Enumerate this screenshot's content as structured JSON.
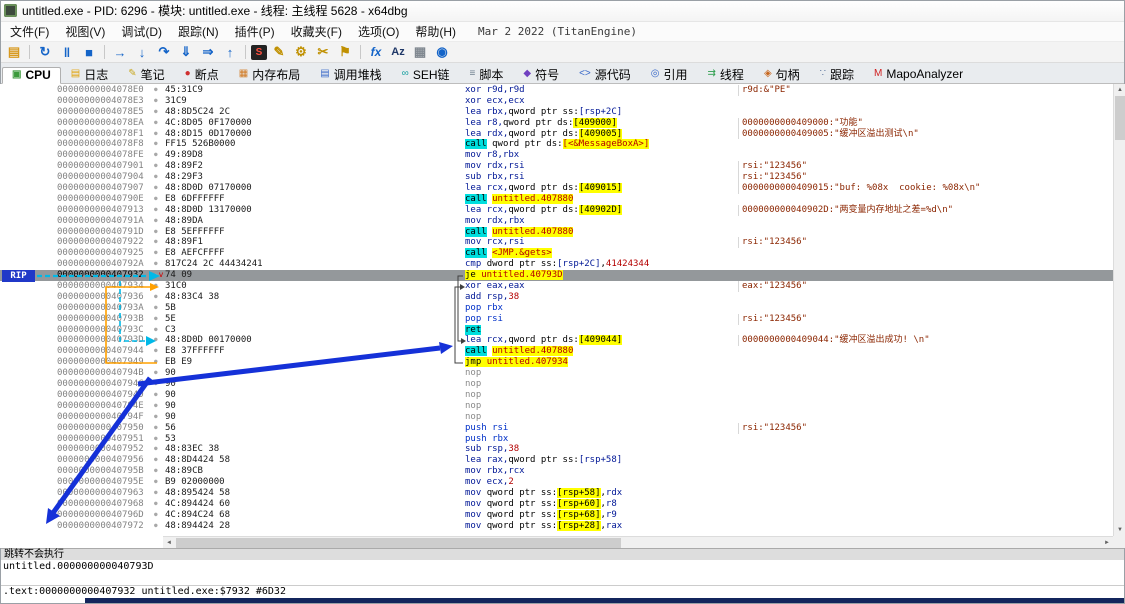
{
  "window": {
    "title": "untitled.exe - PID: 6296 - 模块: untitled.exe - 线程: 主线程 5628 - x64dbg"
  },
  "menu": {
    "items": [
      {
        "name": "menu-file",
        "label": "文件(F)"
      },
      {
        "name": "menu-view",
        "label": "视图(V)"
      },
      {
        "name": "menu-debug",
        "label": "调试(D)"
      },
      {
        "name": "menu-trace",
        "label": "跟踪(N)"
      },
      {
        "name": "menu-plugins",
        "label": "插件(P)"
      },
      {
        "name": "menu-favourites",
        "label": "收藏夹(F)"
      },
      {
        "name": "menu-options",
        "label": "选项(O)"
      },
      {
        "name": "menu-help",
        "label": "帮助(H)"
      }
    ],
    "right_text": "Mar 2 2022 (TitanEngine)"
  },
  "toolbar": {
    "buttons": [
      {
        "name": "open-file-button",
        "glyph": "▤",
        "color": "#d89a20"
      },
      {
        "sep": true
      },
      {
        "name": "restart-button",
        "glyph": "↻",
        "color": "#1464c8"
      },
      {
        "name": "pause-button",
        "glyph": "‖",
        "color": "#1464c8"
      },
      {
        "name": "stop-button",
        "glyph": "■",
        "color": "#1464c8"
      },
      {
        "sep": true
      },
      {
        "name": "run-button",
        "glyph": "→",
        "color": "#1464c8"
      },
      {
        "name": "step-into-button",
        "glyph": "↓",
        "color": "#1464c8"
      },
      {
        "name": "step-over-button",
        "glyph": "↷",
        "color": "#1464c8"
      },
      {
        "name": "trace-into-button",
        "glyph": "⇓",
        "color": "#1464c8"
      },
      {
        "name": "trace-over-button",
        "glyph": "⇒",
        "color": "#1464c8"
      },
      {
        "name": "execute-till-return-button",
        "glyph": "↑",
        "color": "#1464c8"
      },
      {
        "sep": true
      },
      {
        "name": "script-button",
        "glyph": "S",
        "kind": "sbox"
      },
      {
        "name": "notes-button",
        "glyph": "✎",
        "color": "#c09000"
      },
      {
        "name": "settings-button",
        "glyph": "⚙",
        "color": "#c09000"
      },
      {
        "name": "patches-button",
        "glyph": "✂",
        "color": "#c09000"
      },
      {
        "name": "favourites-button",
        "glyph": "⚑",
        "color": "#c09000"
      },
      {
        "sep": true
      },
      {
        "name": "expression-button",
        "glyph": "fx",
        "kind": "fx",
        "color": "#1464c8"
      },
      {
        "name": "strings-button",
        "glyph": "Az",
        "kind": "text",
        "color": "#203868"
      },
      {
        "name": "memory-map-button",
        "glyph": "▦",
        "color": "#808890"
      },
      {
        "name": "about-button",
        "glyph": "◉",
        "color": "#1464c8"
      }
    ]
  },
  "tabs": {
    "items": [
      {
        "name": "tab-cpu",
        "label": "CPU",
        "glyph": "▣",
        "color": "#3c9a3c",
        "selected": true
      },
      {
        "name": "tab-log",
        "label": "日志",
        "glyph": "▤",
        "color": "#e0a000"
      },
      {
        "name": "tab-notes",
        "label": "笔记",
        "glyph": "✎",
        "color": "#c8a820"
      },
      {
        "name": "tab-breakpoints",
        "label": "断点",
        "glyph": "●",
        "color": "#d03030"
      },
      {
        "name": "tab-memory-map",
        "label": "内存布局",
        "glyph": "▦",
        "color": "#d07820"
      },
      {
        "name": "tab-call-stack",
        "label": "调用堆栈",
        "glyph": "▤",
        "color": "#3868c8"
      },
      {
        "name": "tab-seh",
        "label": "SEH链",
        "glyph": "∞",
        "color": "#18a0a0"
      },
      {
        "name": "tab-script",
        "label": "脚本",
        "glyph": "≡",
        "color": "#708090"
      },
      {
        "name": "tab-symbols",
        "label": "符号",
        "glyph": "◆",
        "color": "#7040c0"
      },
      {
        "name": "tab-source",
        "label": "源代码",
        "glyph": "<>",
        "color": "#3868c8"
      },
      {
        "name": "tab-references",
        "label": "引用",
        "glyph": "◎",
        "color": "#3868c8"
      },
      {
        "name": "tab-threads",
        "label": "线程",
        "glyph": "⇉",
        "color": "#30a050"
      },
      {
        "name": "tab-handles",
        "label": "句柄",
        "glyph": "◈",
        "color": "#c86820"
      },
      {
        "name": "tab-trace",
        "label": "跟踪",
        "glyph": "∵",
        "color": "#6078a0"
      },
      {
        "name": "tab-mapo",
        "label": "MapoAnalyzer",
        "glyph": "M",
        "color": "#d02020"
      }
    ]
  },
  "disasm": {
    "rip_label": "RIP",
    "rows": [
      {
        "addr": "00000000004078E0",
        "bytes": "45:31C9",
        "instr": [
          [
            "xor r9d,r9d",
            "mn"
          ]
        ],
        "comment": "r9d:&\"PE\""
      },
      {
        "addr": "00000000004078E3",
        "bytes": "31C9",
        "instr": [
          [
            "xor ecx,ecx",
            "mn"
          ]
        ],
        "comment": ""
      },
      {
        "addr": "00000000004078E5",
        "bytes": "48:8D5C24 2C",
        "instr": [
          [
            "lea rbx,",
            "mn"
          ],
          [
            "qword ptr ss:",
            "pl"
          ],
          [
            "[rsp+2C]",
            "mn"
          ]
        ],
        "comment": ""
      },
      {
        "addr": "00000000004078EA",
        "bytes": "4C:8D05 0F170000",
        "instr": [
          [
            "lea r8,",
            "mn"
          ],
          [
            "qword ptr ds:",
            "pl"
          ],
          [
            "[409000]",
            "tgtk"
          ]
        ],
        "comment": "0000000000409000:\"功能\""
      },
      {
        "addr": "00000000004078F1",
        "bytes": "48:8D15 0D170000",
        "instr": [
          [
            "lea rdx,",
            "mn"
          ],
          [
            "qword ptr ds:",
            "pl"
          ],
          [
            "[409005]",
            "tgtk"
          ]
        ],
        "comment": "0000000000409005:\"缓冲区溢出测试\\n\""
      },
      {
        "addr": "00000000004078F8",
        "bytes": "FF15 526B0000",
        "instr": [
          [
            "call",
            "call"
          ],
          [
            " qword ptr ds:",
            "pl"
          ],
          [
            "[<&MessageBoxA>]",
            "tgt"
          ]
        ],
        "comment": ""
      },
      {
        "addr": "00000000004078FE",
        "bytes": "49:89D8",
        "instr": [
          [
            "mov r8,rbx",
            "mn"
          ]
        ],
        "comment": ""
      },
      {
        "addr": "0000000000407901",
        "bytes": "48:89F2",
        "instr": [
          [
            "mov rdx,rsi",
            "mn"
          ]
        ],
        "comment": "rsi:\"123456\""
      },
      {
        "addr": "0000000000407904",
        "bytes": "48:29F3",
        "instr": [
          [
            "sub rbx,rsi",
            "mn"
          ]
        ],
        "comment": "rsi:\"123456\""
      },
      {
        "addr": "0000000000407907",
        "bytes": "48:8D0D 07170000",
        "instr": [
          [
            "lea rcx,",
            "mn"
          ],
          [
            "qword ptr ds:",
            "pl"
          ],
          [
            "[409015]",
            "tgtk"
          ]
        ],
        "comment": "0000000000409015:\"buf: %08x  cookie: %08x\\n\""
      },
      {
        "addr": "000000000040790E",
        "bytes": "E8 6DFFFFFF",
        "instr": [
          [
            "call",
            "call"
          ],
          [
            " ",
            "pl"
          ],
          [
            "untitled.407880",
            "tgt"
          ]
        ],
        "comment": ""
      },
      {
        "addr": "0000000000407913",
        "bytes": "48:8D0D 13170000",
        "instr": [
          [
            "lea rcx,",
            "mn"
          ],
          [
            "qword ptr ds:",
            "pl"
          ],
          [
            "[40902D]",
            "tgtk"
          ]
        ],
        "comment": "000000000040902D:\"两变量内存地址之差=%d\\n\""
      },
      {
        "addr": "000000000040791A",
        "bytes": "48:89DA",
        "instr": [
          [
            "mov rdx,rbx",
            "mn"
          ]
        ],
        "comment": ""
      },
      {
        "addr": "000000000040791D",
        "bytes": "E8 5EFFFFFF",
        "instr": [
          [
            "call",
            "call"
          ],
          [
            " ",
            "pl"
          ],
          [
            "untitled.407880",
            "tgt"
          ]
        ],
        "comment": ""
      },
      {
        "addr": "0000000000407922",
        "bytes": "48:89F1",
        "instr": [
          [
            "mov rcx,rsi",
            "mn"
          ]
        ],
        "comment": "rsi:\"123456\""
      },
      {
        "addr": "0000000000407925",
        "bytes": "E8 AEFCFFFF",
        "instr": [
          [
            "call",
            "call"
          ],
          [
            " ",
            "pl"
          ],
          [
            "<JMP.&gets>",
            "tgt"
          ]
        ],
        "comment": ""
      },
      {
        "addr": "000000000040792A",
        "bytes": "817C24 2C 44434241",
        "instr": [
          [
            "cmp ",
            "mn"
          ],
          [
            "dword ptr ss:",
            "pl"
          ],
          [
            "[rsp+2C]",
            "mn"
          ],
          [
            ",",
            "pl"
          ],
          [
            "41424344",
            "im"
          ]
        ],
        "comment": ""
      },
      {
        "addr": "0000000000407932",
        "bytes": "74 09",
        "instr": [
          [
            "je ",
            "tgtk"
          ],
          [
            "untitled.40793D",
            "tgt"
          ]
        ],
        "comment": "",
        "selected": true,
        "jump_mark": true
      },
      {
        "addr": "0000000000407934",
        "bytes": "31C0",
        "instr": [
          [
            "xor eax,eax",
            "mn"
          ]
        ],
        "comment": "eax:\"123456\""
      },
      {
        "addr": "0000000000407936",
        "bytes": "48:83C4 38",
        "instr": [
          [
            "add rsp,",
            "mn"
          ],
          [
            "38",
            "im"
          ]
        ],
        "comment": ""
      },
      {
        "addr": "000000000040793A",
        "bytes": "5B",
        "instr": [
          [
            "pop rbx",
            "pp"
          ]
        ],
        "comment": ""
      },
      {
        "addr": "000000000040793B",
        "bytes": "5E",
        "instr": [
          [
            "pop rsi",
            "pp"
          ]
        ],
        "comment": "rsi:\"123456\""
      },
      {
        "addr": "000000000040793C",
        "bytes": "C3",
        "instr": [
          [
            "ret",
            "call"
          ]
        ],
        "comment": ""
      },
      {
        "addr": "000000000040793D",
        "bytes": "48:8D0D 00170000",
        "instr": [
          [
            "lea rcx,",
            "mn"
          ],
          [
            "qword ptr ds:",
            "pl"
          ],
          [
            "[409044]",
            "tgtk"
          ]
        ],
        "comment": "0000000000409044:\"缓冲区溢出成功! \\n\""
      },
      {
        "addr": "0000000000407944",
        "bytes": "E8 37FFFFFF",
        "instr": [
          [
            "call",
            "call"
          ],
          [
            " ",
            "pl"
          ],
          [
            "untitled.407880",
            "tgt"
          ]
        ],
        "comment": ""
      },
      {
        "addr": "0000000000407949",
        "bytes": "EB E9",
        "instr": [
          [
            "jmp ",
            "tgtk"
          ],
          [
            "untitled.407934",
            "tgt"
          ]
        ],
        "comment": ""
      },
      {
        "addr": "000000000040794B",
        "bytes": "90",
        "instr": [
          [
            "nop",
            "nop"
          ]
        ],
        "comment": ""
      },
      {
        "addr": "000000000040794C",
        "bytes": "90",
        "instr": [
          [
            "nop",
            "nop"
          ]
        ],
        "comment": ""
      },
      {
        "addr": "000000000040794D",
        "bytes": "90",
        "instr": [
          [
            "nop",
            "nop"
          ]
        ],
        "comment": ""
      },
      {
        "addr": "000000000040794E",
        "bytes": "90",
        "instr": [
          [
            "nop",
            "nop"
          ]
        ],
        "comment": ""
      },
      {
        "addr": "000000000040794F",
        "bytes": "90",
        "instr": [
          [
            "nop",
            "nop"
          ]
        ],
        "comment": ""
      },
      {
        "addr": "0000000000407950",
        "bytes": "56",
        "instr": [
          [
            "push rsi",
            "pp"
          ]
        ],
        "comment": "rsi:\"123456\""
      },
      {
        "addr": "0000000000407951",
        "bytes": "53",
        "instr": [
          [
            "push rbx",
            "pp"
          ]
        ],
        "comment": ""
      },
      {
        "addr": "0000000000407952",
        "bytes": "48:83EC 38",
        "instr": [
          [
            "sub rsp,",
            "mn"
          ],
          [
            "38",
            "im"
          ]
        ],
        "comment": ""
      },
      {
        "addr": "0000000000407956",
        "bytes": "48:8D4424 58",
        "instr": [
          [
            "lea rax,",
            "mn"
          ],
          [
            "qword ptr ss:",
            "pl"
          ],
          [
            "[rsp+58]",
            "mn"
          ]
        ],
        "comment": ""
      },
      {
        "addr": "000000000040795B",
        "bytes": "48:89CB",
        "instr": [
          [
            "mov rbx,rcx",
            "mn"
          ]
        ],
        "comment": ""
      },
      {
        "addr": "000000000040795E",
        "bytes": "B9 02000000",
        "instr": [
          [
            "mov ecx,",
            "mn"
          ],
          [
            "2",
            "im"
          ]
        ],
        "comment": ""
      },
      {
        "addr": "0000000000407963",
        "bytes": "48:895424 58",
        "instr": [
          [
            "mov ",
            "mn"
          ],
          [
            "qword ptr ss:",
            "pl"
          ],
          [
            "[rsp+58]",
            "tgtk"
          ],
          [
            ",",
            "pl"
          ],
          [
            "rdx",
            "mn"
          ]
        ],
        "comment": ""
      },
      {
        "addr": "0000000000407968",
        "bytes": "4C:894424 60",
        "instr": [
          [
            "mov ",
            "mn"
          ],
          [
            "qword ptr ss:",
            "pl"
          ],
          [
            "[rsp+60]",
            "tgtk"
          ],
          [
            ",",
            "pl"
          ],
          [
            "r8",
            "mn"
          ]
        ],
        "comment": ""
      },
      {
        "addr": "000000000040796D",
        "bytes": "4C:894C24 68",
        "instr": [
          [
            "mov ",
            "mn"
          ],
          [
            "qword ptr ss:",
            "pl"
          ],
          [
            "[rsp+68]",
            "tgtk"
          ],
          [
            ",",
            "pl"
          ],
          [
            "r9",
            "mn"
          ]
        ],
        "comment": ""
      },
      {
        "addr": "0000000000407972",
        "bytes": "48:894424 28",
        "instr": [
          [
            "mov ",
            "mn"
          ],
          [
            "qword ptr ss:",
            "pl"
          ],
          [
            "[rsp+28]",
            "tgtk"
          ],
          [
            ",",
            "pl"
          ],
          [
            "rax",
            "mn"
          ]
        ],
        "comment": ""
      }
    ]
  },
  "info_panel": {
    "line1": "跳转不会执行",
    "line2": "untitled.000000000040793D"
  },
  "status_bar": {
    "text": ".text:0000000000407932 untitled.exe:$7932 #6D32"
  },
  "colors": {
    "selection_bg": "#94989b",
    "call_highlight": "#00dede",
    "jump_highlight": "#ffff00",
    "comment_color": "#8b2500",
    "rip_arrow": "#00b9e8",
    "loop_arrow": "#ffa000",
    "annotation_arrow": "#1531d8"
  }
}
